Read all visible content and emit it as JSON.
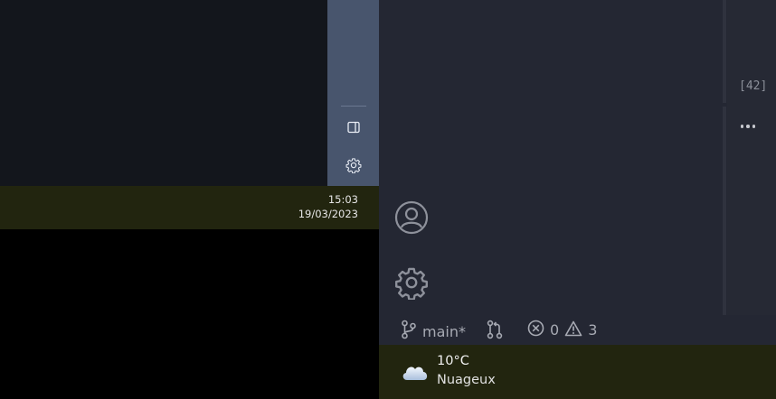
{
  "taskbar": {
    "time": "15:03",
    "date": "19/03/2023"
  },
  "editor": {
    "line_count": "[42]",
    "more_actions_icon": "ellipsis-icon"
  },
  "activity_bar": {
    "account_icon": "account-icon",
    "manage_icon": "gear-icon"
  },
  "side_strip": {
    "toggle_icon": "panel-toggle-icon",
    "settings_icon": "gear-icon"
  },
  "status_bar": {
    "branch": "main*",
    "errors": "0",
    "warnings": "3"
  },
  "weather": {
    "temperature": "10°C",
    "condition": "Nuageux"
  },
  "colors": {
    "editor_bg": "#242733",
    "strip_bg": "#48556d",
    "taskbar_bg": "#22250f",
    "left_editor_bg": "#13161c"
  }
}
